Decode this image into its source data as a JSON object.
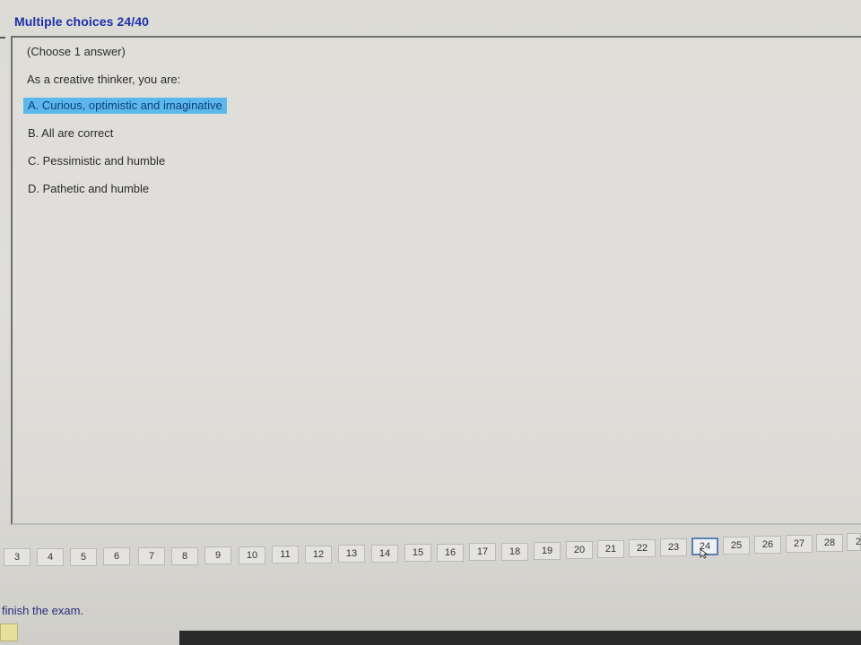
{
  "header": {
    "title": "Multiple choices 24/40"
  },
  "question": {
    "instruction": "(Choose 1 answer)",
    "prompt": "As a creative thinker, you are:",
    "options": [
      {
        "label": "A. Curious, optimistic and imaginative",
        "selected": true
      },
      {
        "label": "B. All are correct",
        "selected": false
      },
      {
        "label": "C. Pessimistic and humble",
        "selected": false
      },
      {
        "label": "D. Pathetic and humble",
        "selected": false
      }
    ]
  },
  "navigation": {
    "current": "24",
    "buttons": [
      "3",
      "4",
      "5",
      "6",
      "7",
      "8",
      "9",
      "10",
      "11",
      "12",
      "13",
      "14",
      "15",
      "16",
      "17",
      "18",
      "19",
      "20",
      "21",
      "22",
      "23",
      "24",
      "25",
      "26",
      "27",
      "28",
      "2"
    ]
  },
  "footer": {
    "finish_label": "finish the exam."
  },
  "colors": {
    "title": "#1f2fa8",
    "selection": "#5cb8ec",
    "current_border": "#5a7fb0"
  },
  "icons": {
    "cursor": "pointer-cursor-icon"
  }
}
